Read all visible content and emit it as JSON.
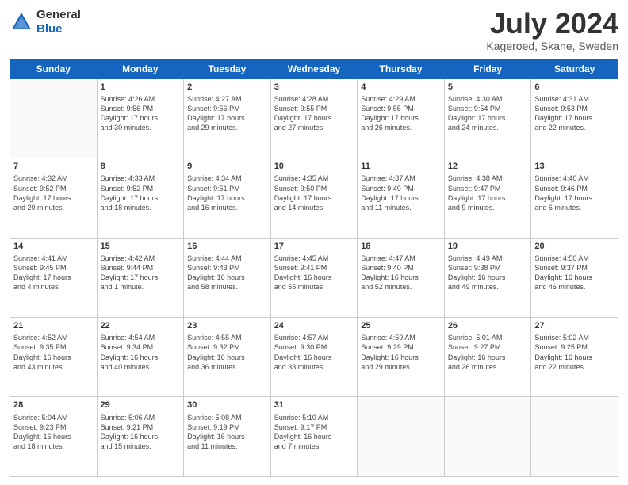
{
  "header": {
    "logo_general": "General",
    "logo_blue": "Blue",
    "month_title": "July 2024",
    "subtitle": "Kageroed, Skane, Sweden"
  },
  "days_of_week": [
    "Sunday",
    "Monday",
    "Tuesday",
    "Wednesday",
    "Thursday",
    "Friday",
    "Saturday"
  ],
  "weeks": [
    [
      {
        "day": "",
        "info": ""
      },
      {
        "day": "1",
        "info": "Sunrise: 4:26 AM\nSunset: 9:56 PM\nDaylight: 17 hours\nand 30 minutes."
      },
      {
        "day": "2",
        "info": "Sunrise: 4:27 AM\nSunset: 9:56 PM\nDaylight: 17 hours\nand 29 minutes."
      },
      {
        "day": "3",
        "info": "Sunrise: 4:28 AM\nSunset: 9:55 PM\nDaylight: 17 hours\nand 27 minutes."
      },
      {
        "day": "4",
        "info": "Sunrise: 4:29 AM\nSunset: 9:55 PM\nDaylight: 17 hours\nand 26 minutes."
      },
      {
        "day": "5",
        "info": "Sunrise: 4:30 AM\nSunset: 9:54 PM\nDaylight: 17 hours\nand 24 minutes."
      },
      {
        "day": "6",
        "info": "Sunrise: 4:31 AM\nSunset: 9:53 PM\nDaylight: 17 hours\nand 22 minutes."
      }
    ],
    [
      {
        "day": "7",
        "info": "Sunrise: 4:32 AM\nSunset: 9:52 PM\nDaylight: 17 hours\nand 20 minutes."
      },
      {
        "day": "8",
        "info": "Sunrise: 4:33 AM\nSunset: 9:52 PM\nDaylight: 17 hours\nand 18 minutes."
      },
      {
        "day": "9",
        "info": "Sunrise: 4:34 AM\nSunset: 9:51 PM\nDaylight: 17 hours\nand 16 minutes."
      },
      {
        "day": "10",
        "info": "Sunrise: 4:35 AM\nSunset: 9:50 PM\nDaylight: 17 hours\nand 14 minutes."
      },
      {
        "day": "11",
        "info": "Sunrise: 4:37 AM\nSunset: 9:49 PM\nDaylight: 17 hours\nand 11 minutes."
      },
      {
        "day": "12",
        "info": "Sunrise: 4:38 AM\nSunset: 9:47 PM\nDaylight: 17 hours\nand 9 minutes."
      },
      {
        "day": "13",
        "info": "Sunrise: 4:40 AM\nSunset: 9:46 PM\nDaylight: 17 hours\nand 6 minutes."
      }
    ],
    [
      {
        "day": "14",
        "info": "Sunrise: 4:41 AM\nSunset: 9:45 PM\nDaylight: 17 hours\nand 4 minutes."
      },
      {
        "day": "15",
        "info": "Sunrise: 4:42 AM\nSunset: 9:44 PM\nDaylight: 17 hours\nand 1 minute."
      },
      {
        "day": "16",
        "info": "Sunrise: 4:44 AM\nSunset: 9:43 PM\nDaylight: 16 hours\nand 58 minutes."
      },
      {
        "day": "17",
        "info": "Sunrise: 4:45 AM\nSunset: 9:41 PM\nDaylight: 16 hours\nand 55 minutes."
      },
      {
        "day": "18",
        "info": "Sunrise: 4:47 AM\nSunset: 9:40 PM\nDaylight: 16 hours\nand 52 minutes."
      },
      {
        "day": "19",
        "info": "Sunrise: 4:49 AM\nSunset: 9:38 PM\nDaylight: 16 hours\nand 49 minutes."
      },
      {
        "day": "20",
        "info": "Sunrise: 4:50 AM\nSunset: 9:37 PM\nDaylight: 16 hours\nand 46 minutes."
      }
    ],
    [
      {
        "day": "21",
        "info": "Sunrise: 4:52 AM\nSunset: 9:35 PM\nDaylight: 16 hours\nand 43 minutes."
      },
      {
        "day": "22",
        "info": "Sunrise: 4:54 AM\nSunset: 9:34 PM\nDaylight: 16 hours\nand 40 minutes."
      },
      {
        "day": "23",
        "info": "Sunrise: 4:55 AM\nSunset: 9:32 PM\nDaylight: 16 hours\nand 36 minutes."
      },
      {
        "day": "24",
        "info": "Sunrise: 4:57 AM\nSunset: 9:30 PM\nDaylight: 16 hours\nand 33 minutes."
      },
      {
        "day": "25",
        "info": "Sunrise: 4:59 AM\nSunset: 9:29 PM\nDaylight: 16 hours\nand 29 minutes."
      },
      {
        "day": "26",
        "info": "Sunrise: 5:01 AM\nSunset: 9:27 PM\nDaylight: 16 hours\nand 26 minutes."
      },
      {
        "day": "27",
        "info": "Sunrise: 5:02 AM\nSunset: 9:25 PM\nDaylight: 16 hours\nand 22 minutes."
      }
    ],
    [
      {
        "day": "28",
        "info": "Sunrise: 5:04 AM\nSunset: 9:23 PM\nDaylight: 16 hours\nand 18 minutes."
      },
      {
        "day": "29",
        "info": "Sunrise: 5:06 AM\nSunset: 9:21 PM\nDaylight: 16 hours\nand 15 minutes."
      },
      {
        "day": "30",
        "info": "Sunrise: 5:08 AM\nSunset: 9:19 PM\nDaylight: 16 hours\nand 11 minutes."
      },
      {
        "day": "31",
        "info": "Sunrise: 5:10 AM\nSunset: 9:17 PM\nDaylight: 16 hours\nand 7 minutes."
      },
      {
        "day": "",
        "info": ""
      },
      {
        "day": "",
        "info": ""
      },
      {
        "day": "",
        "info": ""
      }
    ]
  ]
}
